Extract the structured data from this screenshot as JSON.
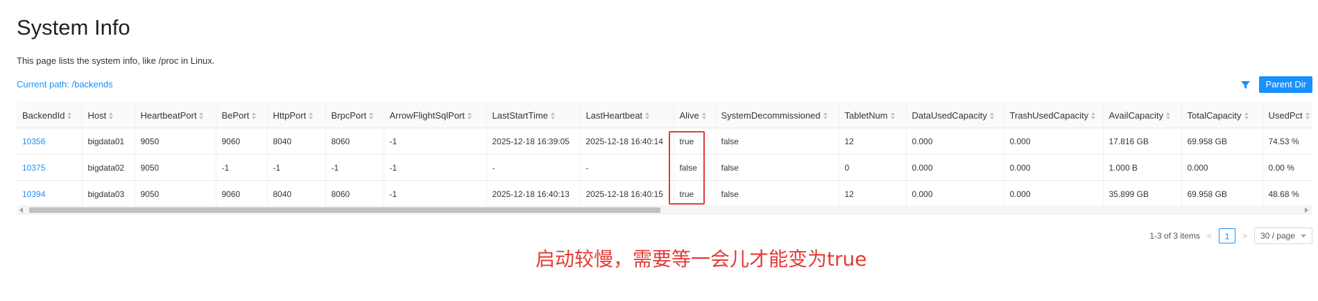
{
  "page": {
    "title": "System Info",
    "description": "This page lists the system info, like /proc in Linux.",
    "current_path": "Current path: /backends",
    "parent_dir_label": "Parent Dir"
  },
  "table": {
    "columns": [
      "BackendId",
      "Host",
      "HeartbeatPort",
      "BePort",
      "HttpPort",
      "BrpcPort",
      "ArrowFlightSqlPort",
      "LastStartTime",
      "LastHeartbeat",
      "Alive",
      "SystemDecommissioned",
      "TabletNum",
      "DataUsedCapacity",
      "TrashUsedCapacity",
      "AvailCapacity",
      "TotalCapacity",
      "UsedPct"
    ],
    "rows": [
      [
        "10356",
        "bigdata01",
        "9050",
        "9060",
        "8040",
        "8060",
        "-1",
        "2025-12-18 16:39:05",
        "2025-12-18 16:40:14",
        "true",
        "false",
        "12",
        "0.000",
        "0.000",
        "17.816 GB",
        "69.958 GB",
        "74.53 %"
      ],
      [
        "10375",
        "bigdata02",
        "9050",
        "-1",
        "-1",
        "-1",
        "-1",
        "-",
        "-",
        "false",
        "false",
        "0",
        "0.000",
        "0.000",
        "1.000 B",
        "0.000",
        "0.00 %"
      ],
      [
        "10394",
        "bigdata03",
        "9050",
        "9060",
        "8040",
        "8060",
        "-1",
        "2025-12-18 16:40:13",
        "2025-12-18 16:40:15",
        "true",
        "false",
        "12",
        "0.000",
        "0.000",
        "35.899 GB",
        "69.958 GB",
        "48.68 %"
      ]
    ]
  },
  "pagination": {
    "summary": "1-3 of 3 items",
    "current_page": "1",
    "page_size": "30 / page"
  },
  "annotation": {
    "text": "启动较慢，需要等一会儿才能变为true",
    "color": "#e53935"
  },
  "colors": {
    "accent": "#1890ff",
    "highlight": "#e53935"
  }
}
